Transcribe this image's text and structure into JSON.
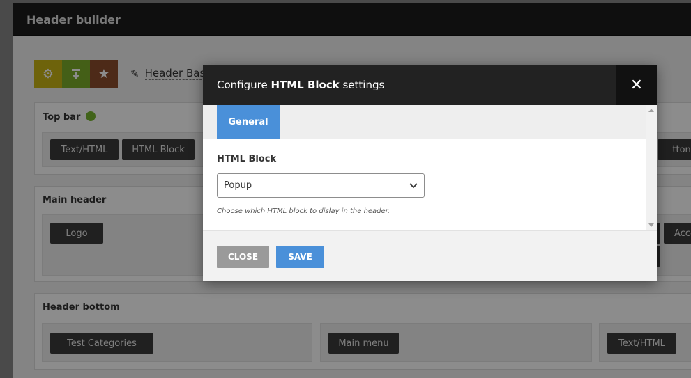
{
  "app": {
    "title": "Header builder"
  },
  "toolbar": {
    "buttons": [
      {
        "icon": "gear-icon",
        "color": "#c9b414"
      },
      {
        "icon": "import-icon",
        "color": "#7cae2a"
      },
      {
        "icon": "star-icon",
        "color": "#8c4d2d"
      }
    ],
    "layout_name": "Header Bas"
  },
  "sections": {
    "top_bar": {
      "title": "Top bar",
      "chips": [
        "Text/HTML",
        "HTML Block",
        "ttons"
      ]
    },
    "main_header": {
      "title": "Main header",
      "chips": [
        "Logo",
        "Acco"
      ]
    },
    "header_bottom": {
      "title": "Header bottom",
      "chips": [
        "Test Categories",
        "Main menu",
        "Text/HTML"
      ]
    }
  },
  "modal": {
    "title_prefix": "Configure ",
    "title_bold": "HTML Block",
    "title_suffix": " settings",
    "close_icon": "close-icon",
    "tab_label": "General",
    "field_label": "HTML Block",
    "select_value": "Popup",
    "hint": "Choose which HTML block to dislay in the header.",
    "close_label": "CLOSE",
    "save_label": "SAVE"
  },
  "colors": {
    "accent": "#4a90d9",
    "status_green": "#77b52e"
  }
}
